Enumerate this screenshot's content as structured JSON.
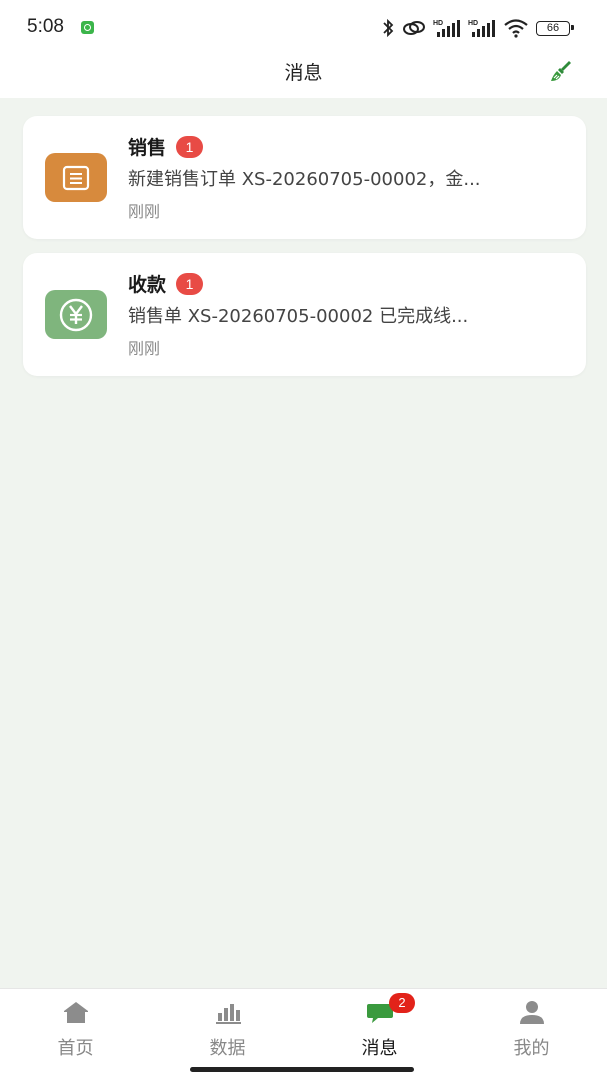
{
  "status_bar": {
    "time": "5:08",
    "battery": "66",
    "icons": [
      "app-notification-icon",
      "bluetooth-icon",
      "link-icon",
      "signal-hd-icon",
      "signal-hd-icon",
      "wifi-icon",
      "battery-icon"
    ]
  },
  "navbar": {
    "title": "消息",
    "action_icon": "broom-icon"
  },
  "messages": [
    {
      "title": "销售",
      "badge": "1",
      "description": "新建销售订单 XS-20260705-00002，金...",
      "time": "刚刚",
      "icon": "document-icon",
      "icon_color": "#d78a3d"
    },
    {
      "title": "收款",
      "badge": "1",
      "description": "销售单 XS-20260705-00002 已完成线...",
      "time": "刚刚",
      "icon": "yen-icon",
      "icon_color": "#7fb57d"
    }
  ],
  "tabbar": {
    "tabs": [
      {
        "label": "首页",
        "icon": "home-icon"
      },
      {
        "label": "数据",
        "icon": "bar-chart-icon"
      },
      {
        "label": "消息",
        "icon": "chat-icon",
        "badge": "2",
        "active": true
      },
      {
        "label": "我的",
        "icon": "user-icon"
      }
    ]
  },
  "colors": {
    "accent": "#3a9a3e",
    "badge_red": "#e84b45",
    "background": "#f0f4ef"
  }
}
